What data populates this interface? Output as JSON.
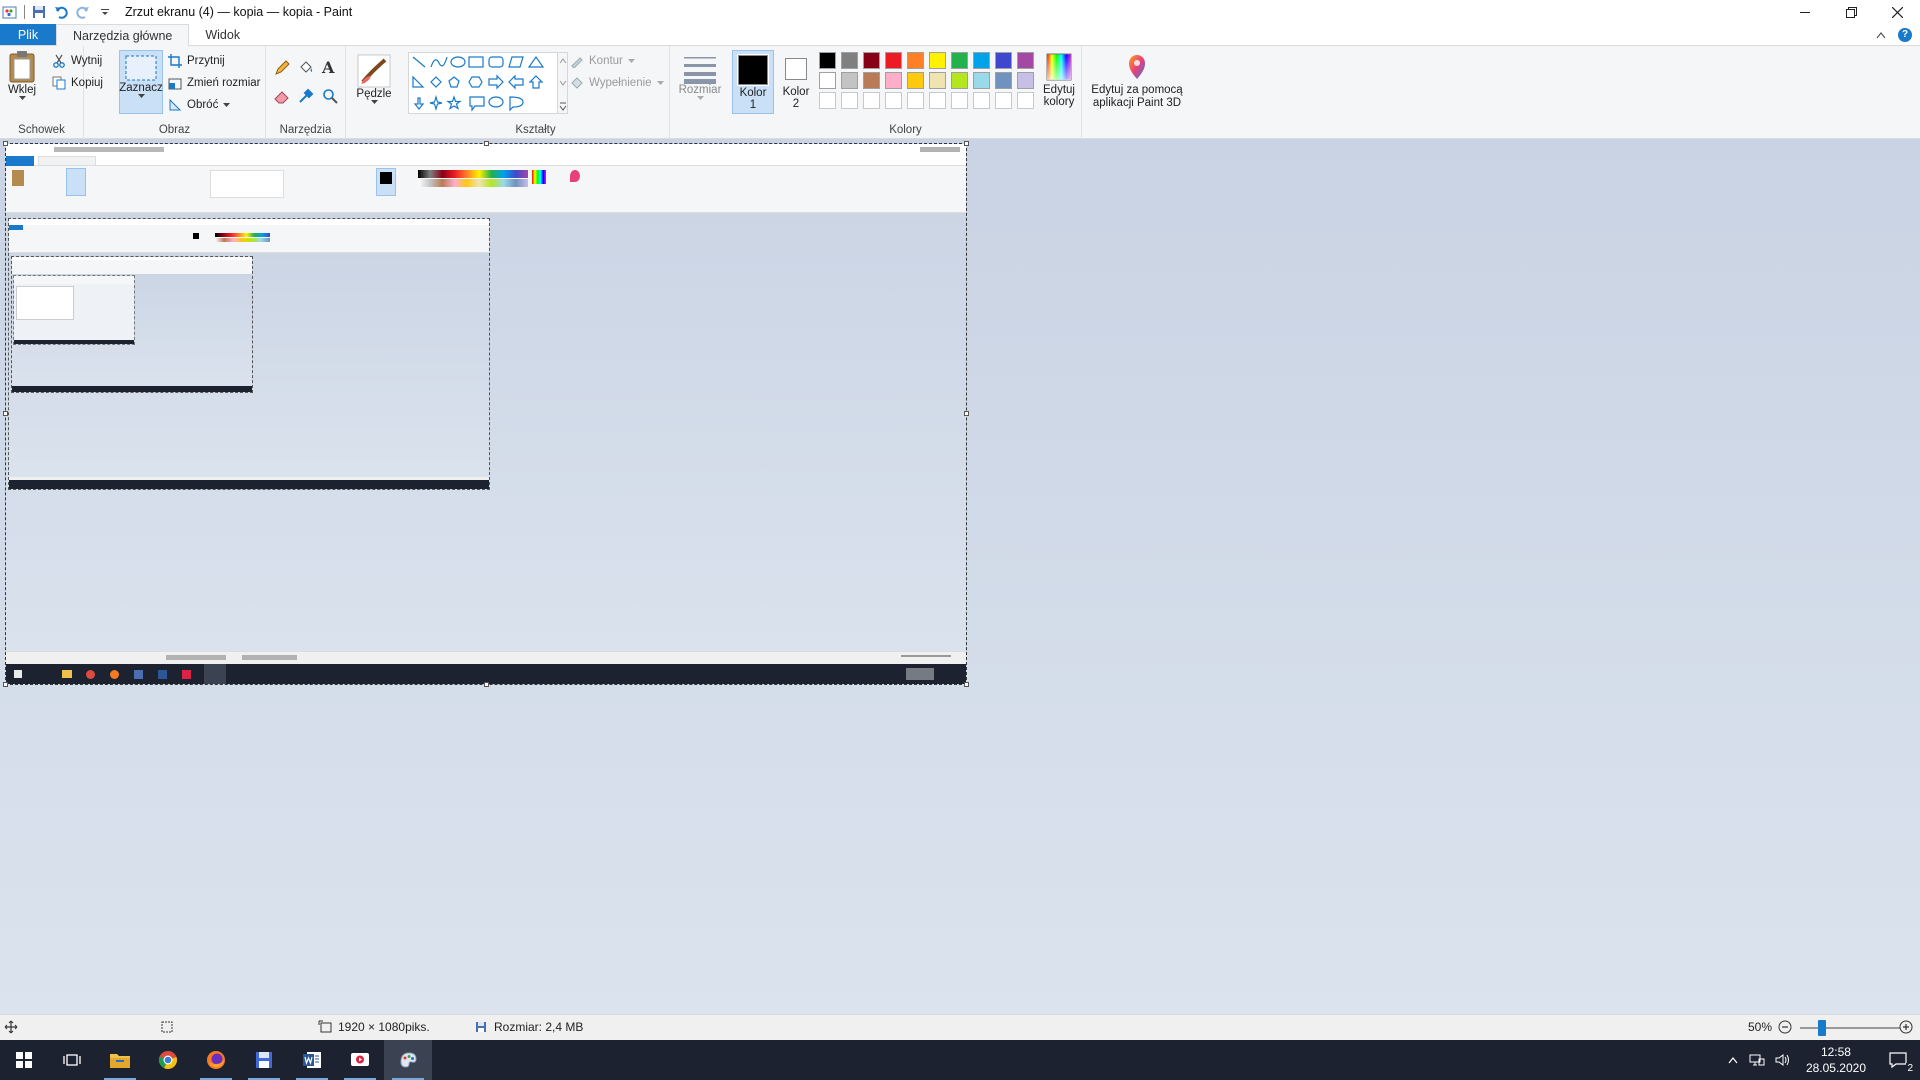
{
  "window": {
    "title": "Zrzut ekranu (4) — kopia — kopia - Paint",
    "controls": [
      "minimize",
      "restore",
      "close"
    ]
  },
  "tabs": [
    {
      "label": "Plik"
    },
    {
      "label": "Narzędzia główne"
    },
    {
      "label": "Widok"
    }
  ],
  "ribbon": {
    "clipboard": {
      "paste": "Wklej",
      "cut": "Wytnij",
      "copy": "Kopiuj",
      "label": "Schowek"
    },
    "image": {
      "select": "Zaznacz",
      "crop": "Przytnij",
      "resize": "Zmień rozmiar",
      "rotate": "Obróć",
      "label": "Obraz"
    },
    "tools": {
      "label": "Narzędzia",
      "brushes": "Pędzle"
    },
    "shapes": {
      "outline": "Kontur",
      "fill": "Wypełnienie",
      "label": "Kształty"
    },
    "size": {
      "label": "Rozmiar"
    },
    "colors": {
      "color1": "Kolor 1",
      "color2": "Kolor 2",
      "edit": "Edytuj kolory",
      "label": "Kolory",
      "palette_row1": [
        "#000000",
        "#7f7f7f",
        "#880015",
        "#ed1c24",
        "#ff7f27",
        "#fff200",
        "#22b14c",
        "#00a2e8",
        "#3f48cc",
        "#a349a4"
      ],
      "palette_row2": [
        "#ffffff",
        "#c3c3c3",
        "#b97a57",
        "#ffaec9",
        "#ffc90e",
        "#efe4b0",
        "#b5e61d",
        "#99d9ea",
        "#7092be",
        "#c8bfe7"
      ],
      "palette_row3": [
        "#ffffff",
        "#ffffff",
        "#ffffff",
        "#ffffff",
        "#ffffff",
        "#ffffff",
        "#ffffff",
        "#ffffff",
        "#ffffff",
        "#ffffff"
      ]
    },
    "paint3d": {
      "label": "Edytuj za pomocą aplikacji Paint 3D"
    }
  },
  "status": {
    "dimensions": "1920 × 1080piks.",
    "size": "Rozmiar: 2,4 MB",
    "zoom": "50%",
    "zoom_level": 0.5
  },
  "taskbar": {
    "apps": [
      "start-icon",
      "task-view-icon",
      "file-explorer-icon",
      "chrome-icon",
      "firefox-icon",
      "save-app-icon",
      "word-icon",
      "video-app-icon",
      "paint-icon"
    ],
    "time": "12:58",
    "date": "28.05.2020",
    "notifications": "2"
  }
}
